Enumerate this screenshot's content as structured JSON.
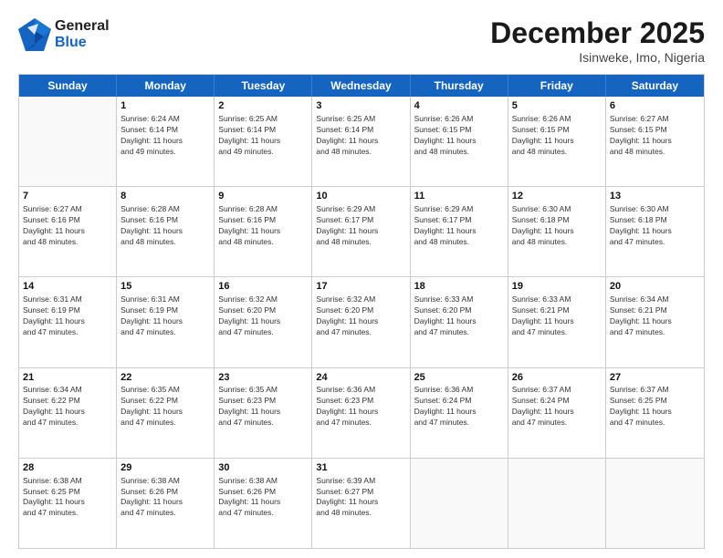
{
  "header": {
    "logo_general": "General",
    "logo_blue": "Blue",
    "month_title": "December 2025",
    "location": "Isinweke, Imo, Nigeria"
  },
  "days_of_week": [
    "Sunday",
    "Monday",
    "Tuesday",
    "Wednesday",
    "Thursday",
    "Friday",
    "Saturday"
  ],
  "weeks": [
    [
      {
        "day": "",
        "info": ""
      },
      {
        "day": "1",
        "info": "Sunrise: 6:24 AM\nSunset: 6:14 PM\nDaylight: 11 hours\nand 49 minutes."
      },
      {
        "day": "2",
        "info": "Sunrise: 6:25 AM\nSunset: 6:14 PM\nDaylight: 11 hours\nand 49 minutes."
      },
      {
        "day": "3",
        "info": "Sunrise: 6:25 AM\nSunset: 6:14 PM\nDaylight: 11 hours\nand 48 minutes."
      },
      {
        "day": "4",
        "info": "Sunrise: 6:26 AM\nSunset: 6:15 PM\nDaylight: 11 hours\nand 48 minutes."
      },
      {
        "day": "5",
        "info": "Sunrise: 6:26 AM\nSunset: 6:15 PM\nDaylight: 11 hours\nand 48 minutes."
      },
      {
        "day": "6",
        "info": "Sunrise: 6:27 AM\nSunset: 6:15 PM\nDaylight: 11 hours\nand 48 minutes."
      }
    ],
    [
      {
        "day": "7",
        "info": "Sunrise: 6:27 AM\nSunset: 6:16 PM\nDaylight: 11 hours\nand 48 minutes."
      },
      {
        "day": "8",
        "info": "Sunrise: 6:28 AM\nSunset: 6:16 PM\nDaylight: 11 hours\nand 48 minutes."
      },
      {
        "day": "9",
        "info": "Sunrise: 6:28 AM\nSunset: 6:16 PM\nDaylight: 11 hours\nand 48 minutes."
      },
      {
        "day": "10",
        "info": "Sunrise: 6:29 AM\nSunset: 6:17 PM\nDaylight: 11 hours\nand 48 minutes."
      },
      {
        "day": "11",
        "info": "Sunrise: 6:29 AM\nSunset: 6:17 PM\nDaylight: 11 hours\nand 48 minutes."
      },
      {
        "day": "12",
        "info": "Sunrise: 6:30 AM\nSunset: 6:18 PM\nDaylight: 11 hours\nand 48 minutes."
      },
      {
        "day": "13",
        "info": "Sunrise: 6:30 AM\nSunset: 6:18 PM\nDaylight: 11 hours\nand 47 minutes."
      }
    ],
    [
      {
        "day": "14",
        "info": "Sunrise: 6:31 AM\nSunset: 6:19 PM\nDaylight: 11 hours\nand 47 minutes."
      },
      {
        "day": "15",
        "info": "Sunrise: 6:31 AM\nSunset: 6:19 PM\nDaylight: 11 hours\nand 47 minutes."
      },
      {
        "day": "16",
        "info": "Sunrise: 6:32 AM\nSunset: 6:20 PM\nDaylight: 11 hours\nand 47 minutes."
      },
      {
        "day": "17",
        "info": "Sunrise: 6:32 AM\nSunset: 6:20 PM\nDaylight: 11 hours\nand 47 minutes."
      },
      {
        "day": "18",
        "info": "Sunrise: 6:33 AM\nSunset: 6:20 PM\nDaylight: 11 hours\nand 47 minutes."
      },
      {
        "day": "19",
        "info": "Sunrise: 6:33 AM\nSunset: 6:21 PM\nDaylight: 11 hours\nand 47 minutes."
      },
      {
        "day": "20",
        "info": "Sunrise: 6:34 AM\nSunset: 6:21 PM\nDaylight: 11 hours\nand 47 minutes."
      }
    ],
    [
      {
        "day": "21",
        "info": "Sunrise: 6:34 AM\nSunset: 6:22 PM\nDaylight: 11 hours\nand 47 minutes."
      },
      {
        "day": "22",
        "info": "Sunrise: 6:35 AM\nSunset: 6:22 PM\nDaylight: 11 hours\nand 47 minutes."
      },
      {
        "day": "23",
        "info": "Sunrise: 6:35 AM\nSunset: 6:23 PM\nDaylight: 11 hours\nand 47 minutes."
      },
      {
        "day": "24",
        "info": "Sunrise: 6:36 AM\nSunset: 6:23 PM\nDaylight: 11 hours\nand 47 minutes."
      },
      {
        "day": "25",
        "info": "Sunrise: 6:36 AM\nSunset: 6:24 PM\nDaylight: 11 hours\nand 47 minutes."
      },
      {
        "day": "26",
        "info": "Sunrise: 6:37 AM\nSunset: 6:24 PM\nDaylight: 11 hours\nand 47 minutes."
      },
      {
        "day": "27",
        "info": "Sunrise: 6:37 AM\nSunset: 6:25 PM\nDaylight: 11 hours\nand 47 minutes."
      }
    ],
    [
      {
        "day": "28",
        "info": "Sunrise: 6:38 AM\nSunset: 6:25 PM\nDaylight: 11 hours\nand 47 minutes."
      },
      {
        "day": "29",
        "info": "Sunrise: 6:38 AM\nSunset: 6:26 PM\nDaylight: 11 hours\nand 47 minutes."
      },
      {
        "day": "30",
        "info": "Sunrise: 6:38 AM\nSunset: 6:26 PM\nDaylight: 11 hours\nand 47 minutes."
      },
      {
        "day": "31",
        "info": "Sunrise: 6:39 AM\nSunset: 6:27 PM\nDaylight: 11 hours\nand 48 minutes."
      },
      {
        "day": "",
        "info": ""
      },
      {
        "day": "",
        "info": ""
      },
      {
        "day": "",
        "info": ""
      }
    ]
  ]
}
